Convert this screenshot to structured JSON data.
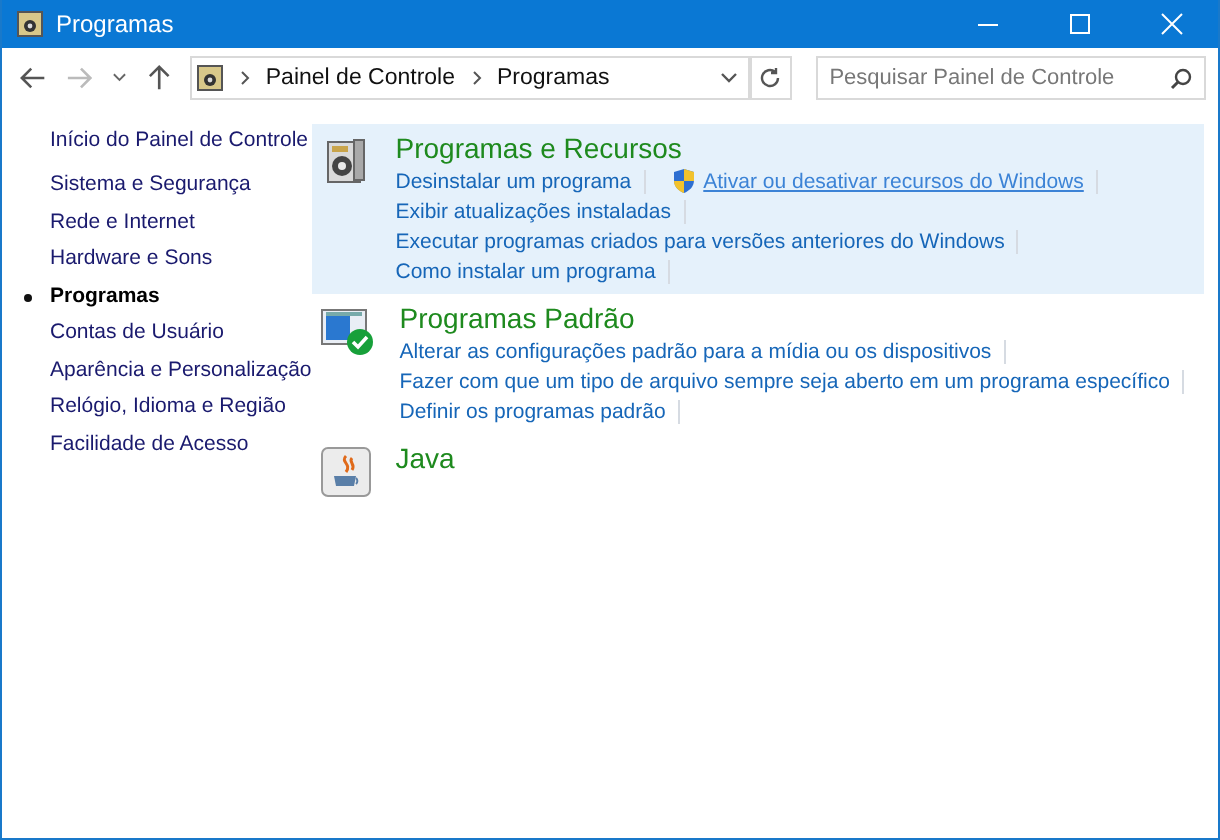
{
  "window": {
    "title": "Programas"
  },
  "address": {
    "crumbs": [
      "Painel de Controle",
      "Programas"
    ]
  },
  "search": {
    "placeholder": "Pesquisar Painel de Controle"
  },
  "sidebar": {
    "home": "Início do Painel de Controle",
    "items": [
      {
        "label": "Sistema e Segurança",
        "selected": false
      },
      {
        "label": "Rede e Internet",
        "selected": false
      },
      {
        "label": "Hardware e Sons",
        "selected": false
      },
      {
        "label": "Programas",
        "selected": true
      },
      {
        "label": "Contas de Usuário",
        "selected": false
      },
      {
        "label": "Aparência e Personalização",
        "selected": false
      },
      {
        "label": "Relógio, Idioma e Região",
        "selected": false
      },
      {
        "label": "Facilidade de Acesso",
        "selected": false
      }
    ]
  },
  "categories": [
    {
      "title": "Programas e Recursos",
      "kind": "programs",
      "highlighted": true,
      "lines": [
        [
          {
            "label": "Desinstalar um programa",
            "shield": false,
            "hovered": false
          },
          {
            "label": "Ativar ou desativar recursos do Windows",
            "shield": true,
            "hovered": true
          }
        ],
        [
          {
            "label": "Exibir atualizações instaladas",
            "shield": false,
            "hovered": false
          }
        ],
        [
          {
            "label": "Executar programas criados para versões anteriores do Windows",
            "shield": false,
            "hovered": false
          }
        ],
        [
          {
            "label": "Como instalar um programa",
            "shield": false,
            "hovered": false
          }
        ]
      ]
    },
    {
      "title": "Programas Padrão",
      "kind": "defaults",
      "highlighted": false,
      "lines": [
        [
          {
            "label": "Alterar as configurações padrão para a mídia ou os dispositivos",
            "shield": false,
            "hovered": false
          }
        ],
        [
          {
            "label": "Fazer com que um tipo de arquivo sempre seja aberto em um programa específico",
            "shield": false,
            "hovered": false
          }
        ],
        [
          {
            "label": "Definir os programas padrão",
            "shield": false,
            "hovered": false
          }
        ]
      ]
    },
    {
      "title": "Java",
      "kind": "java",
      "highlighted": false
    }
  ]
}
